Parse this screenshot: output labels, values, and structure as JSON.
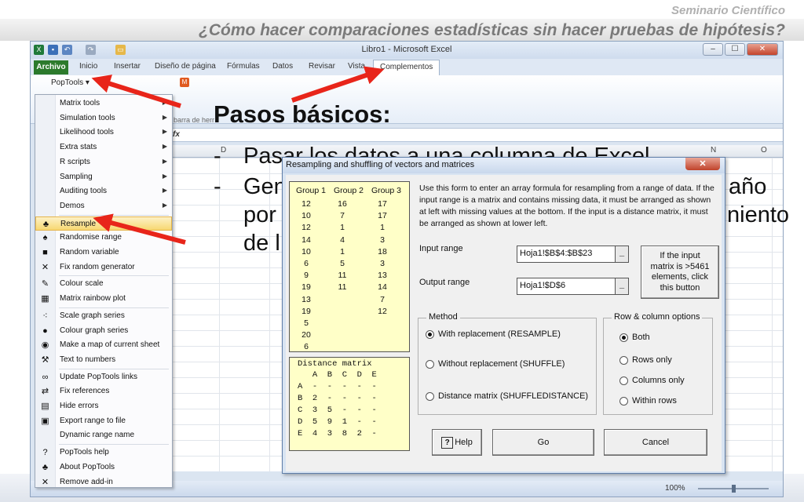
{
  "slide": {
    "subtitle": "Seminario Científico",
    "title": "¿Cómo hacer comparaciones estadísticas sin hacer pruebas de hipótesis?",
    "heading": "Pasos básicos:",
    "bullets": [
      {
        "dash": "-",
        "lines": [
          "Pasar los datos a una columna de Excel"
        ]
      },
      {
        "dash": "-",
        "lines": [
          "Gen",
          "por",
          "de l"
        ]
      }
    ],
    "bullet2_right": [
      "año",
      "niento"
    ]
  },
  "excel": {
    "window_title": "Libro1 - Microsoft Excel",
    "tabs": [
      "Archivo",
      "Inicio",
      "Insertar",
      "Diseño de página",
      "Fórmulas",
      "Datos",
      "Revisar",
      "Vista",
      "Complementos"
    ],
    "active_tab": "Complementos",
    "window_buttons": [
      "–",
      "☐",
      "✕"
    ],
    "poptools_label": "PopTools ▾",
    "ribbon_group_label": "barra de herr",
    "formula_bar_fx": "fx",
    "columns": [
      "D",
      "N",
      "O"
    ],
    "zoom": "100%",
    "zoom_level": 0.5
  },
  "menu": {
    "items": [
      {
        "label": "Matrix tools",
        "icon": "",
        "submenu": true
      },
      {
        "label": "Simulation tools",
        "icon": "",
        "submenu": true
      },
      {
        "label": "Likelihood tools",
        "icon": "",
        "submenu": true
      },
      {
        "label": "Extra stats",
        "icon": "",
        "submenu": true
      },
      {
        "label": "R scripts",
        "icon": "",
        "submenu": true
      },
      {
        "label": "Sampling",
        "icon": "",
        "submenu": true
      },
      {
        "label": "Auditing tools",
        "icon": "",
        "submenu": true
      },
      {
        "label": "Demos",
        "icon": "",
        "submenu": true
      },
      {
        "label": "Resample",
        "icon": "♣",
        "highlighted": true
      },
      {
        "label": "Randomise range",
        "icon": "♠"
      },
      {
        "label": "Random variable",
        "icon": "■"
      },
      {
        "label": "Fix random generator",
        "icon": "✕"
      },
      {
        "label": "Colour scale",
        "icon": "✎"
      },
      {
        "label": "Matrix rainbow plot",
        "icon": "▦"
      },
      {
        "label": "Scale graph series",
        "icon": "⁖"
      },
      {
        "label": "Colour graph series",
        "icon": "●"
      },
      {
        "label": "Make a map of current sheet",
        "icon": "◉"
      },
      {
        "label": "Text to numbers",
        "icon": "⚒"
      },
      {
        "label": "Update PopTools links",
        "icon": "∞"
      },
      {
        "label": "Fix references",
        "icon": "⇄"
      },
      {
        "label": "Hide errors",
        "icon": "▤"
      },
      {
        "label": "Export range to file",
        "icon": "▣"
      },
      {
        "label": "Dynamic range name",
        "icon": ""
      },
      {
        "label": "PopTools help",
        "icon": "?"
      },
      {
        "label": "About PopTools",
        "icon": "♣"
      },
      {
        "label": "Remove add-in",
        "icon": "✕"
      }
    ]
  },
  "dialog": {
    "title": "Resampling and shuffling of vectors and matrices",
    "close": "✕",
    "group_headers": [
      "Group 1",
      "Group 2",
      "Group 3"
    ],
    "groups": [
      [
        "12",
        "10",
        "12",
        "14",
        "10",
        "6",
        "9",
        "19",
        "13",
        "19",
        "5",
        "20",
        "6"
      ],
      [
        "16",
        "7",
        "1",
        "4",
        "1",
        "5",
        "11",
        "11"
      ],
      [
        "17",
        "17",
        "1",
        "3",
        "18",
        "3",
        "13",
        "14",
        "7",
        "12"
      ]
    ],
    "distance": {
      "title": "Distance matrix",
      "header": "   A  B  C  D  E",
      "rows": [
        "A  -  -  -  -  -",
        "B  2  -  -  -  -",
        "C  3  5  -  -  -",
        "D  5  9  1  -  -",
        "E  4  3  8  2  -"
      ]
    },
    "instructions": "Use this form to enter an array formula for resampling from a range of data. If the input range is a matrix and contains missing data, it must be arranged as shown at left with missing values at the bottom. If the input is a distance matrix, it must be arranged as shown at lower left.",
    "input_range_label": "Input range",
    "input_range_value": "Hoja1!$B$4:$B$23",
    "output_range_label": "Output range",
    "output_range_value": "Hoja1!$D$6",
    "range_button": "_",
    "big_button": [
      "If the input",
      "matrix is >5461",
      "elements, click",
      "this button"
    ],
    "method_title": "Method",
    "methods": [
      {
        "label": "With replacement (RESAMPLE)",
        "checked": true
      },
      {
        "label": "Without replacement (SHUFFLE)",
        "checked": false
      },
      {
        "label": "Distance matrix (SHUFFLEDISTANCE)",
        "checked": false
      }
    ],
    "rc_title": "Row & column options",
    "rc_options": [
      {
        "label": "Both",
        "checked": true
      },
      {
        "label": "Rows only",
        "checked": false
      },
      {
        "label": "Columns only",
        "checked": false
      },
      {
        "label": "Within rows",
        "checked": false
      }
    ],
    "help_label": "Help",
    "go_label": "Go",
    "cancel_label": "Cancel"
  },
  "colors": {
    "arrow": "#e8251a",
    "highlight": "#f7d872",
    "yellow_box": "#ffffc8"
  }
}
